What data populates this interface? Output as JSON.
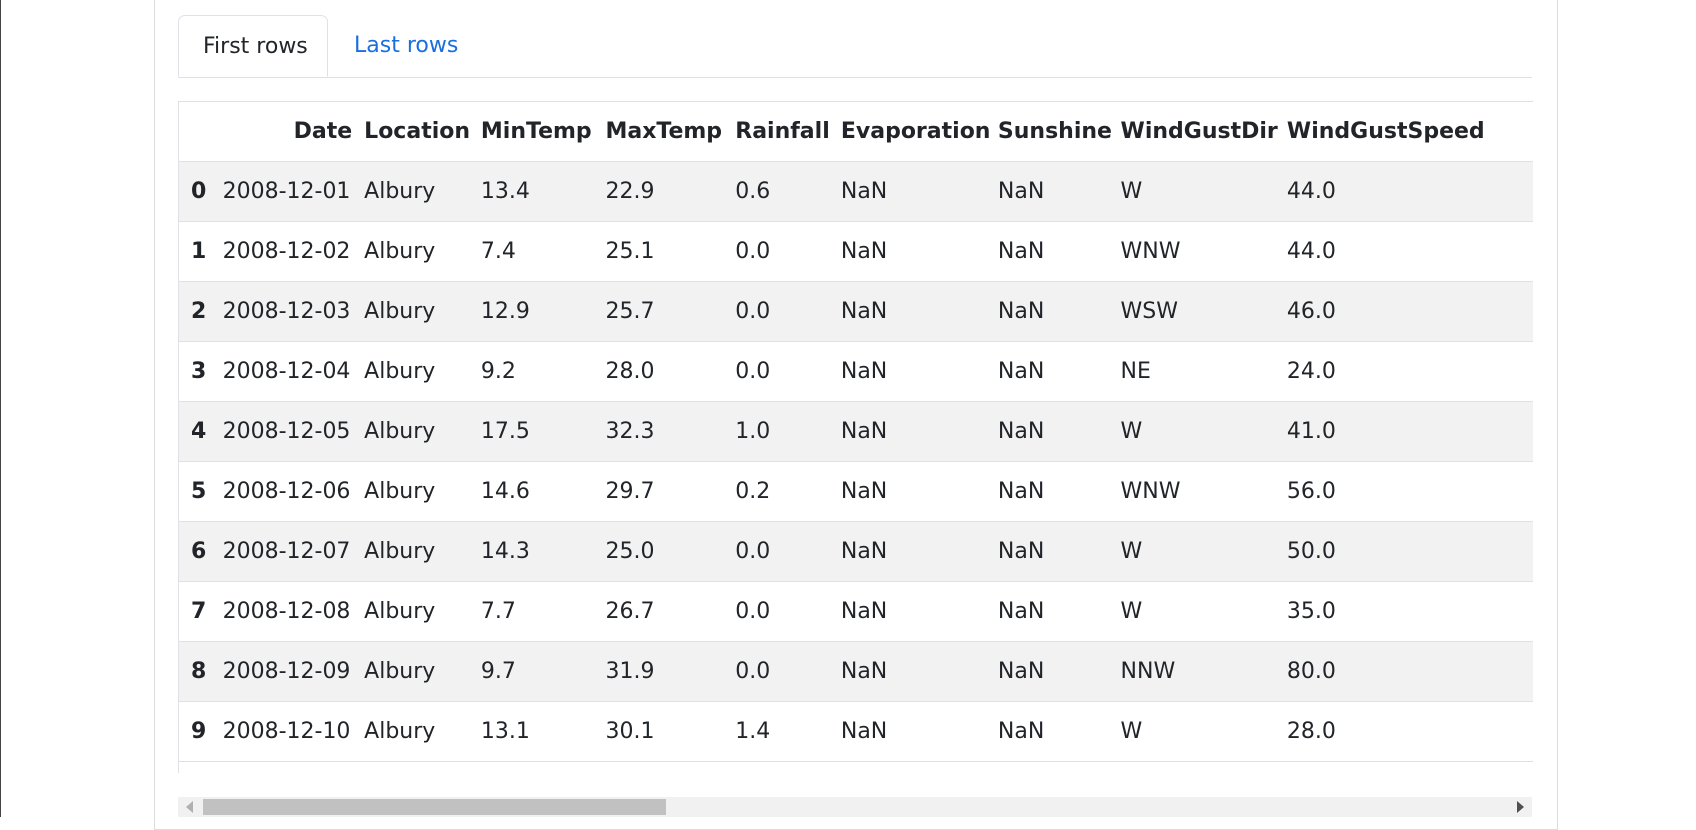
{
  "tabs": {
    "first_rows": "First rows",
    "last_rows": "Last rows"
  },
  "table": {
    "columns": [
      "Date",
      "Location",
      "MinTemp",
      "MaxTemp",
      "Rainfall",
      "Evaporation",
      "Sunshine",
      "WindGustDir",
      "WindGustSpeed"
    ],
    "rows": [
      {
        "index": "0",
        "cells": [
          "2008-12-01",
          "Albury",
          "13.4",
          "22.9",
          "0.6",
          "NaN",
          "NaN",
          "W",
          "44.0"
        ]
      },
      {
        "index": "1",
        "cells": [
          "2008-12-02",
          "Albury",
          "7.4",
          "25.1",
          "0.0",
          "NaN",
          "NaN",
          "WNW",
          "44.0"
        ]
      },
      {
        "index": "2",
        "cells": [
          "2008-12-03",
          "Albury",
          "12.9",
          "25.7",
          "0.0",
          "NaN",
          "NaN",
          "WSW",
          "46.0"
        ]
      },
      {
        "index": "3",
        "cells": [
          "2008-12-04",
          "Albury",
          "9.2",
          "28.0",
          "0.0",
          "NaN",
          "NaN",
          "NE",
          "24.0"
        ]
      },
      {
        "index": "4",
        "cells": [
          "2008-12-05",
          "Albury",
          "17.5",
          "32.3",
          "1.0",
          "NaN",
          "NaN",
          "W",
          "41.0"
        ]
      },
      {
        "index": "5",
        "cells": [
          "2008-12-06",
          "Albury",
          "14.6",
          "29.7",
          "0.2",
          "NaN",
          "NaN",
          "WNW",
          "56.0"
        ]
      },
      {
        "index": "6",
        "cells": [
          "2008-12-07",
          "Albury",
          "14.3",
          "25.0",
          "0.0",
          "NaN",
          "NaN",
          "W",
          "50.0"
        ]
      },
      {
        "index": "7",
        "cells": [
          "2008-12-08",
          "Albury",
          "7.7",
          "26.7",
          "0.0",
          "NaN",
          "NaN",
          "W",
          "35.0"
        ]
      },
      {
        "index": "8",
        "cells": [
          "2008-12-09",
          "Albury",
          "9.7",
          "31.9",
          "0.0",
          "NaN",
          "NaN",
          "NNW",
          "80.0"
        ]
      },
      {
        "index": "9",
        "cells": [
          "2008-12-10",
          "Albury",
          "13.1",
          "30.1",
          "1.4",
          "NaN",
          "NaN",
          "W",
          "28.0"
        ]
      }
    ]
  },
  "colors": {
    "link": "#1a6fe0",
    "stripe": "#f2f2f2",
    "border": "#dee2e6"
  },
  "icons": {
    "scroll_left": "scroll-left-arrow-icon",
    "scroll_right": "scroll-right-arrow-icon"
  }
}
